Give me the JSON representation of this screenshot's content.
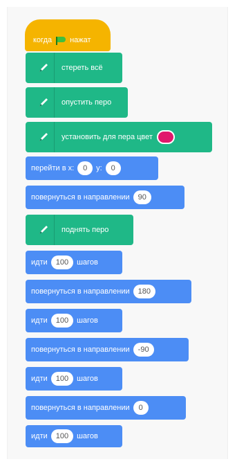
{
  "hat": {
    "pre": "когда",
    "post": "нажат"
  },
  "pen": {
    "erase_all": "стереть всё",
    "pen_down": "опустить перо",
    "set_color": "установить для пера цвет",
    "pen_color": "#e0186c",
    "pen_up": "поднять перо"
  },
  "goto": {
    "pre": "перейти в x:",
    "x": "0",
    "mid": "y:",
    "y": "0"
  },
  "turn": {
    "label": "повернуться в направлении"
  },
  "move": {
    "pre": "идти",
    "post": "шагов"
  },
  "values": {
    "dir1": "90",
    "step1": "100",
    "dir2": "180",
    "step2": "100",
    "dir3": "-90",
    "step3": "100",
    "dir4": "0",
    "step4": "100"
  },
  "colors": {
    "events": "#f5b400",
    "pen": "#1fb887",
    "motion": "#4c8df5"
  }
}
